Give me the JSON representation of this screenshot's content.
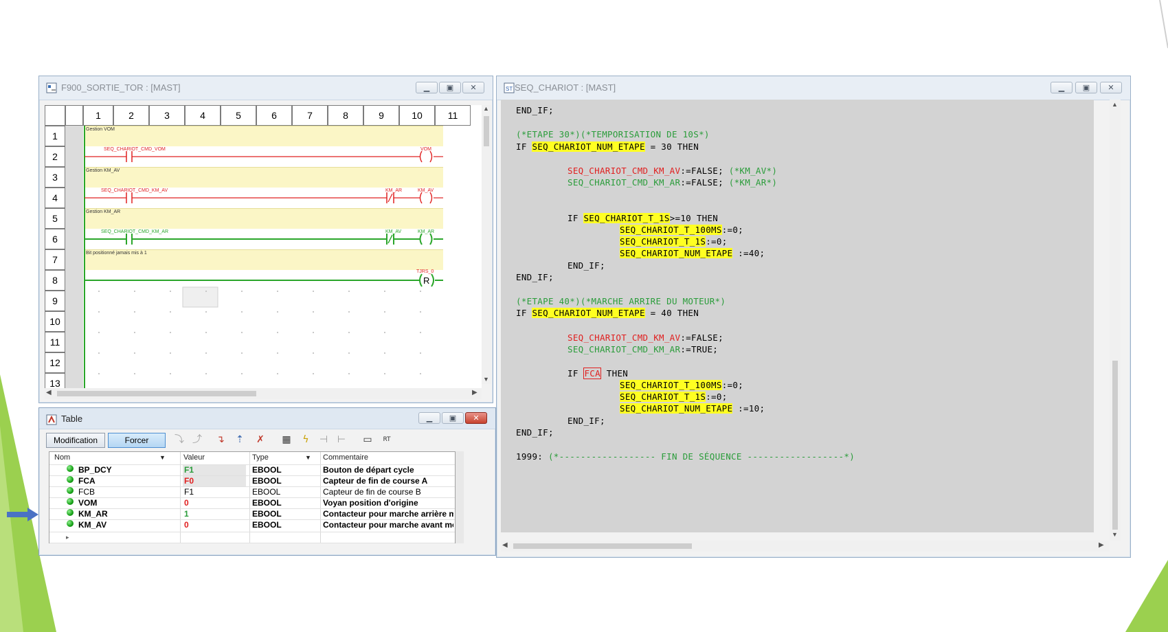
{
  "ladder_window": {
    "title": "F900_SORTIE_TOR : [MAST]",
    "columns": [
      "1",
      "2",
      "3",
      "4",
      "5",
      "6",
      "7",
      "8",
      "9",
      "10",
      "11"
    ],
    "rows": [
      "1",
      "2",
      "3",
      "4",
      "5",
      "6",
      "7",
      "8",
      "9",
      "10",
      "11",
      "12",
      "13"
    ],
    "comments": [
      "Gestion VOM",
      "Gestion KM_AV",
      "Gestion KM_AR",
      "Bit positionné jamais mis à 1"
    ],
    "rungs": {
      "r2": {
        "contact": "SEQ_CHARIOT_CMD_VOM",
        "coil": "VOM"
      },
      "r4": {
        "contact": "SEQ_CHARIOT_CMD_KM_AV",
        "interlock": "KM_AR",
        "coil": "KM_AV"
      },
      "r6": {
        "contact": "SEQ_CHARIOT_CMD_KM_AR",
        "interlock": "KM_AV",
        "coil": "KM_AR"
      },
      "r8": {
        "coil": "TJRS_0",
        "coil_symbol": "R"
      }
    }
  },
  "code_window": {
    "title": "SEQ_CHARIOT : [MAST]",
    "lines": [
      {
        "t": "END_IF;"
      },
      {
        "t": "(*ETAPE 30*)(*TEMPORISATION DE 10S*)"
      },
      {
        "t1": "IF ",
        "v": "SEQ_CHARIOT_NUM_ETAPE",
        "t2": " = 30 THEN"
      },
      {
        "v": "SEQ_CHARIOT_CMD_KM_AV",
        "t": ":=FALSE; ",
        "c": "(*KM_AV*)"
      },
      {
        "v": "SEQ_CHARIOT_CMD_KM_AR",
        "t": ":=FALSE; ",
        "c": "(*KM_AR*)"
      },
      {
        "t1": "IF ",
        "v": "SEQ_CHARIOT_T_1S",
        "t2": ">=10 THEN"
      },
      {
        "v": "SEQ_CHARIOT_T_100MS",
        "t": ":=0;"
      },
      {
        "v": "SEQ_CHARIOT_T_1S",
        "t": ":=0;"
      },
      {
        "v": "SEQ_CHARIOT_NUM_ETAPE",
        "t": " :=40;"
      },
      {
        "t": "END_IF;"
      },
      {
        "t": "END_IF;"
      },
      {
        "t": "(*ETAPE 40*)(*MARCHE ARRIRE DU MOTEUR*)"
      },
      {
        "t1": "IF ",
        "v": "SEQ_CHARIOT_NUM_ETAPE",
        "t2": " = 40 THEN"
      },
      {
        "v": "SEQ_CHARIOT_CMD_KM_AV",
        "t": ":=FALSE;"
      },
      {
        "v": "SEQ_CHARIOT_CMD_KM_AR",
        "t": ":=TRUE;"
      },
      {
        "t1": "IF ",
        "v": "FCA",
        "t2": " THEN"
      },
      {
        "v": "SEQ_CHARIOT_T_100MS",
        "t": ":=0;"
      },
      {
        "v": "SEQ_CHARIOT_T_1S",
        "t": ":=0;"
      },
      {
        "v": "SEQ_CHARIOT_NUM_ETAPE",
        "t": " :=10;"
      },
      {
        "t": "END_IF;"
      },
      {
        "t": "END_IF;"
      },
      {
        "t1": "1999: ",
        "c": "(*------------------ FIN DE SÉQUENCE ------------------*)"
      }
    ]
  },
  "table_window": {
    "title": "Table",
    "tabs": {
      "modification": "Modification",
      "forcer": "Forcer"
    },
    "headers": {
      "nom": "Nom",
      "valeur": "Valeur",
      "type": "Type",
      "commentaire": "Commentaire"
    },
    "rows": [
      {
        "nom": "BP_DCY",
        "valeur": "F1",
        "type": "EBOOL",
        "commentaire": "Bouton de départ cycle",
        "valeur_color": "#2a9c3a"
      },
      {
        "nom": "FCA",
        "valeur": "F0",
        "type": "EBOOL",
        "commentaire": "Capteur de fin de course A",
        "valeur_color": "#e02020"
      },
      {
        "nom": "FCB",
        "valeur": "F1",
        "type": "EBOOL",
        "commentaire": "Capteur de fin de course B",
        "valeur_color": "#000000"
      },
      {
        "nom": "VOM",
        "valeur": "0",
        "type": "EBOOL",
        "commentaire": "Voyan position d'origine",
        "valeur_color": "#e02020"
      },
      {
        "nom": "KM_AR",
        "valeur": "1",
        "type": "EBOOL",
        "commentaire": "Contacteur pour marche arrière mo...",
        "valeur_color": "#2a9c3a"
      },
      {
        "nom": "KM_AV",
        "valeur": "0",
        "type": "EBOOL",
        "commentaire": "Contacteur pour marche avant mot...",
        "valeur_color": "#e02020"
      }
    ]
  },
  "colors": {
    "accent_blue": "#4a72c4",
    "slide_green": "#9bd04f",
    "highlight": "#ffff22",
    "contact_red": "#e02020",
    "contact_green": "#2aa62a"
  }
}
